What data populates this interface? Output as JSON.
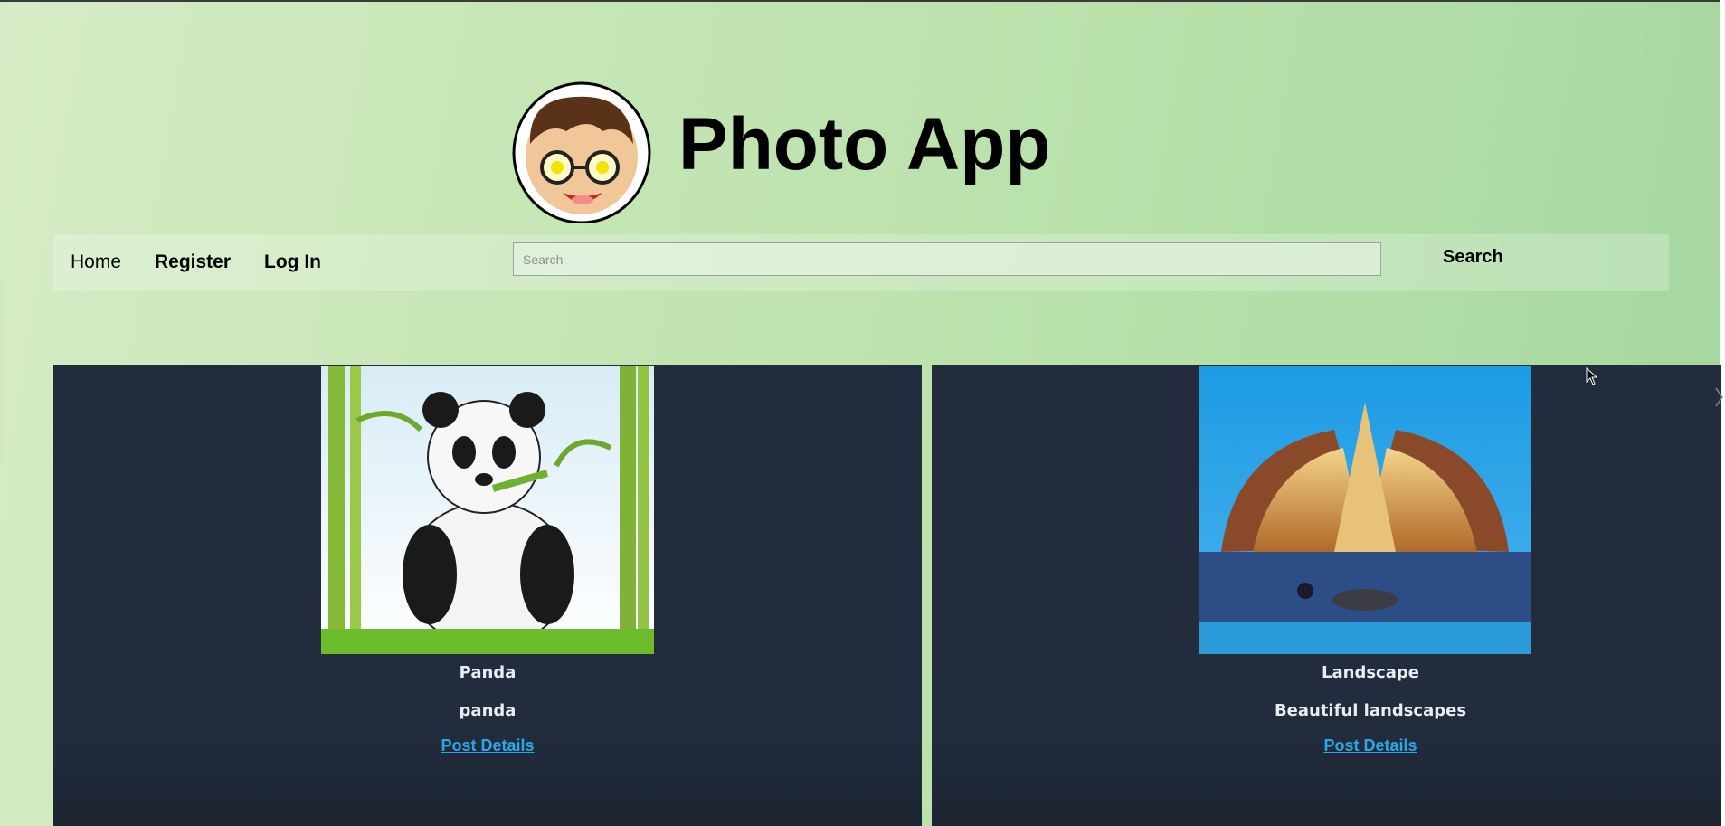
{
  "header": {
    "title": "Photo App",
    "logo_icon": "cartoon-avatar-logo"
  },
  "nav": {
    "home_label": "Home",
    "register_label": "Register",
    "login_label": "Log In"
  },
  "search": {
    "placeholder": "Search",
    "value": "",
    "button_label": "Search"
  },
  "posts": [
    {
      "title": "Panda",
      "description": "panda",
      "link_label": "Post Details",
      "image_icon": "panda-photo"
    },
    {
      "title": "Landscape",
      "description": "Beautiful landscapes",
      "link_label": "Post Details",
      "image_icon": "monument-landscape-photo"
    }
  ],
  "colors": {
    "card_bg": "#222c3c",
    "link": "#2aa7e8",
    "card_text": "#e9edf2"
  }
}
